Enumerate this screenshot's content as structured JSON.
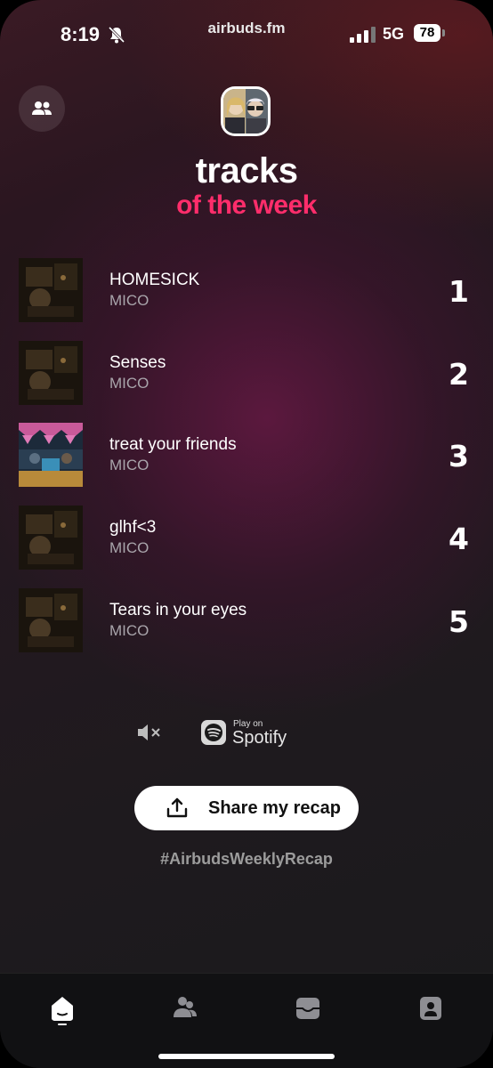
{
  "status_bar": {
    "time": "8:19",
    "url": "airbuds.fm",
    "network": "5G",
    "battery": "78"
  },
  "header": {
    "title_line1": "tracks",
    "title_line2": "of the week"
  },
  "tracks": [
    {
      "title": "HOMESICK",
      "artist": "MICO",
      "rank": "1"
    },
    {
      "title": "Senses",
      "artist": "MICO",
      "rank": "2"
    },
    {
      "title": "treat your friends",
      "artist": "MICO",
      "rank": "3"
    },
    {
      "title": "glhf<3",
      "artist": "MICO",
      "rank": "4"
    },
    {
      "title": "Tears in your eyes",
      "artist": "MICO",
      "rank": "5"
    }
  ],
  "spotify": {
    "small": "Play on",
    "big": "Spotify"
  },
  "share_button": "Share my recap",
  "hashtag": "#AirbudsWeeklyRecap",
  "colors": {
    "accent": "#ff2d6b",
    "background": "#1e1a1e"
  },
  "icons": {
    "friends": "people-icon",
    "mute": "speaker-muted-icon",
    "share": "share-upload-icon",
    "tabs": [
      "home-icon",
      "friends-icon",
      "inbox-icon",
      "profile-icon"
    ]
  }
}
